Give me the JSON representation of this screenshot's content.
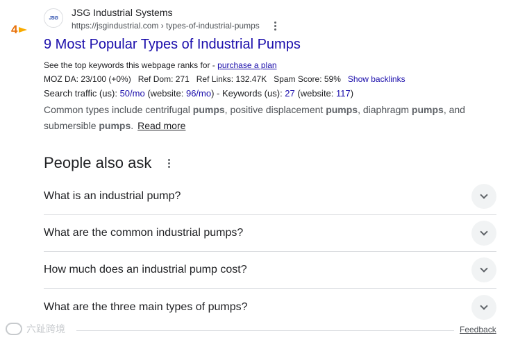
{
  "result": {
    "rank": "4",
    "favicon_text": "JSG",
    "site_name": "JSG Industrial Systems",
    "url": "https://jsgindustrial.com",
    "url_path": " › types-of-industrial-pumps",
    "title": "9 Most Popular Types of Industrial Pumps",
    "seo": {
      "keywords_prefix": "See the top keywords this webpage ranks for - ",
      "keywords_link": "purchase a plan",
      "moz_da": "MOZ DA: 23/100 (+0%)",
      "ref_dom": "Ref Dom: 271",
      "ref_links": "Ref Links: 132.47K",
      "spam_score": "Spam Score: 59%",
      "backlinks_link": "Show backlinks",
      "traffic_label": "Search traffic (us): ",
      "traffic_value": "50/mo",
      "traffic_site_open": " (website: ",
      "traffic_site_value": "96/mo",
      "traffic_site_close": ") - Keywords (us): ",
      "keywords_value": "27",
      "keywords_site_open": " (website: ",
      "keywords_site_value": "117",
      "keywords_site_close": ")"
    },
    "snippet": {
      "p1": "Common types include centrifugal ",
      "b1": "pumps",
      "p2": ", positive displacement ",
      "b2": "pumps",
      "p3": ", diaphragm ",
      "b3": "pumps",
      "p4": ", and submersible ",
      "b4": "pumps",
      "p5": ".",
      "read_more": "Read more"
    }
  },
  "paa": {
    "title": "People also ask",
    "questions": [
      "What is an industrial pump?",
      "What are the common industrial pumps?",
      "How much does an industrial pump cost?",
      "What are the three main types of pumps?"
    ]
  },
  "footer": {
    "watermark": "六趾跨境",
    "feedback": "Feedback"
  },
  "colors": {
    "link": "#1a0dab",
    "rank": "#e8710a",
    "chip_bg": "#f1f3f4"
  }
}
